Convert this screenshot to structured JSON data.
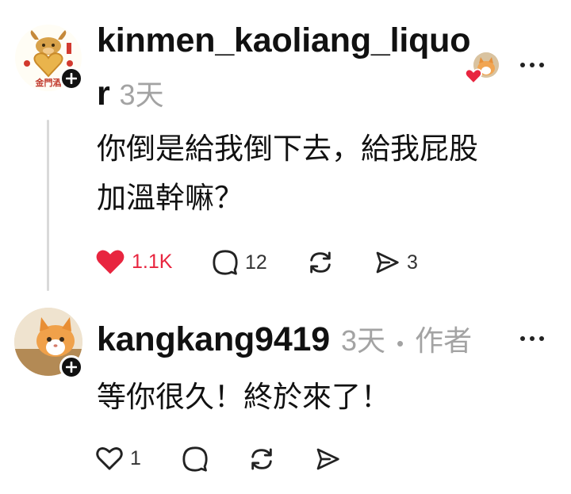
{
  "colors": {
    "like_red": "#e8253f",
    "muted": "#a3a3a3",
    "line": "#d9d9d9"
  },
  "reply": {
    "username_line1": "kinmen_kaoliang_liquo",
    "username_line2": "r",
    "time": "3天",
    "text_line1": "你倒是給我倒下去，給我屁股",
    "text_line2": "加溫幹嘛？",
    "avatar_logo_text": "金門酒",
    "likes": "1.1K",
    "comments": "12",
    "shares": "3",
    "liked": true
  },
  "comment": {
    "username": "kangkang9419",
    "time": "3天",
    "separator": "•",
    "author_tag": "作者",
    "text": "等你很久！終於來了！",
    "likes": "1",
    "liked": false
  }
}
